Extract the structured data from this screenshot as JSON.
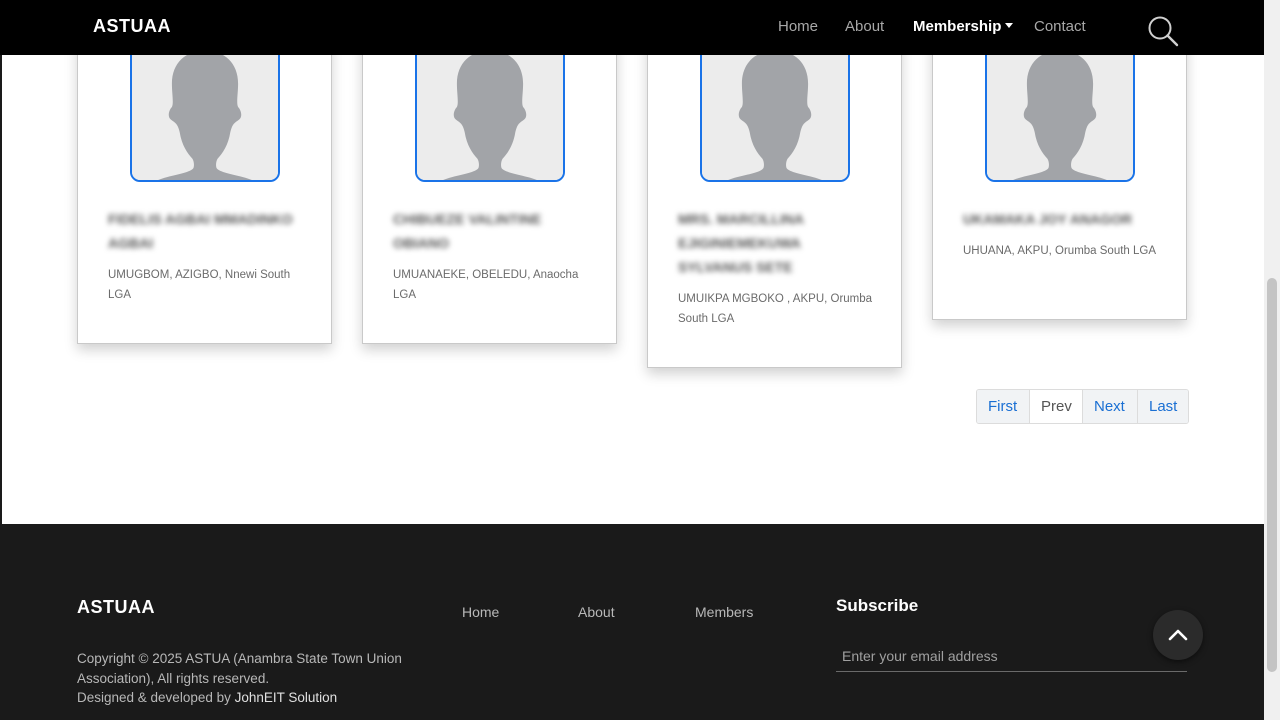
{
  "nav": {
    "brand": "ASTUAA",
    "links": [
      {
        "label": "Home"
      },
      {
        "label": "About"
      },
      {
        "label": "Membership"
      },
      {
        "label": "Contact"
      }
    ]
  },
  "members": [
    {
      "name": "FIDELIS AGBAI MMADINKO AGBAI",
      "location": "UMUGBOM, AZIGBO, Nnewi South LGA"
    },
    {
      "name": "CHIBUEZE VALINTINE OBIANO",
      "location": "UMUANAEKE, OBELEDU, Anaocha LGA"
    },
    {
      "name": "MRS. MARCILLINA EJIGINIEMEKUWA SYLVANUS SETE",
      "location": "UMUIKPA MGBOKO , AKPU, Orumba South LGA"
    },
    {
      "name": "UKAMAKA JOY ANAGOR",
      "location": "UHUANA, AKPU, Orumba South LGA"
    }
  ],
  "pagination": {
    "first": "First",
    "prev": "Prev",
    "next": "Next",
    "last": "Last"
  },
  "footer": {
    "brand": "ASTUAA",
    "copyright": "Copyright © 2025 ASTUA (Anambra State Town Union Association), All rights reserved.",
    "designed_prefix": "Designed & developed by ",
    "developer": "JohnEIT Solution",
    "links": [
      {
        "label": "Home"
      },
      {
        "label": "About"
      },
      {
        "label": "Members"
      }
    ],
    "subscribe_title": "Subscribe",
    "email_placeholder": "Enter your email address"
  },
  "colors": {
    "accent": "#1a73e8",
    "nav_bg": "#000000",
    "footer_bg": "#1a1a1a"
  },
  "icons": {
    "search": "search-icon",
    "scroll_top": "chevron-up-icon",
    "avatar": "avatar-placeholder-icon"
  }
}
